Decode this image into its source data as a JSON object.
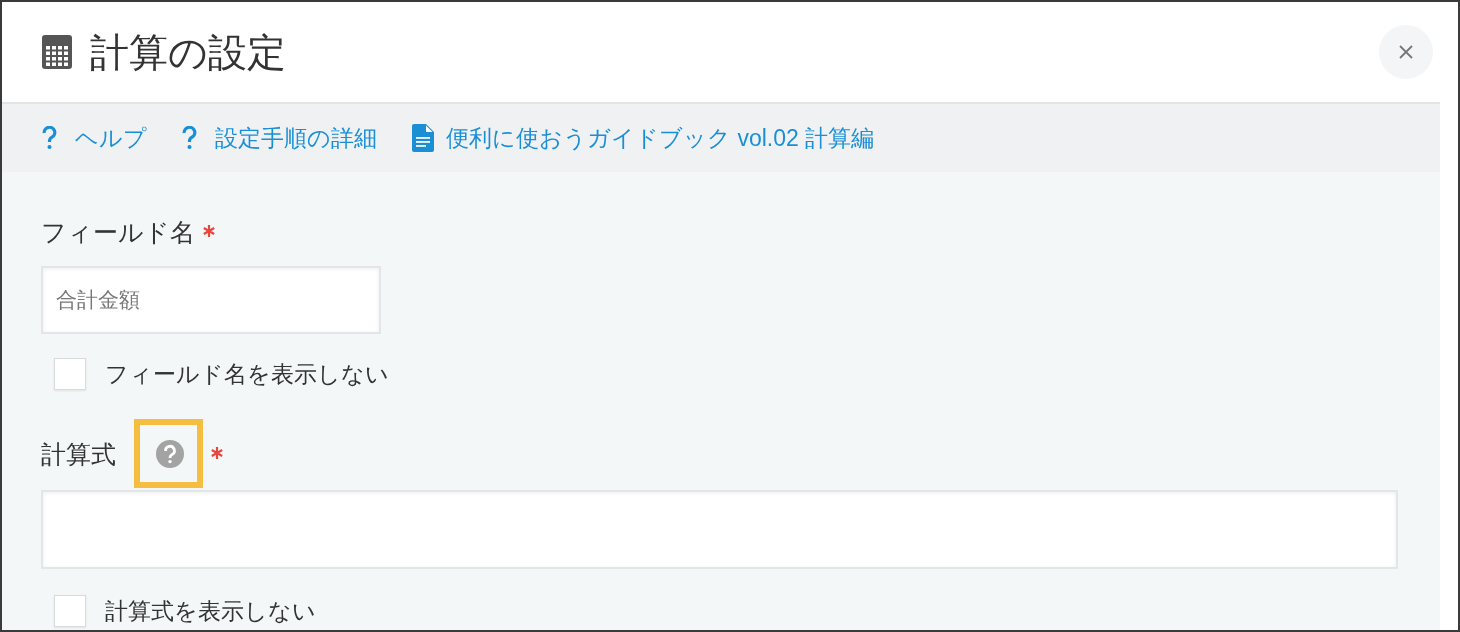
{
  "dialog": {
    "title": "計算の設定"
  },
  "help_links": [
    {
      "kind": "help",
      "label": "ヘルプ"
    },
    {
      "kind": "help",
      "label": "設定手順の詳細"
    },
    {
      "kind": "document",
      "label": "便利に使おうガイドブック vol.02 計算編"
    }
  ],
  "fields": [
    {
      "kind": "text",
      "label": "フィールド名",
      "required": true,
      "value": "合計金額",
      "hide_option": {
        "label": "フィールド名を表示しない",
        "checked": false
      }
    },
    {
      "kind": "formula",
      "label": "計算式",
      "required": true,
      "help_icon": {
        "highlighted": true
      },
      "hide_option": {
        "label": "計算式を表示しない",
        "checked": false
      }
    }
  ]
}
